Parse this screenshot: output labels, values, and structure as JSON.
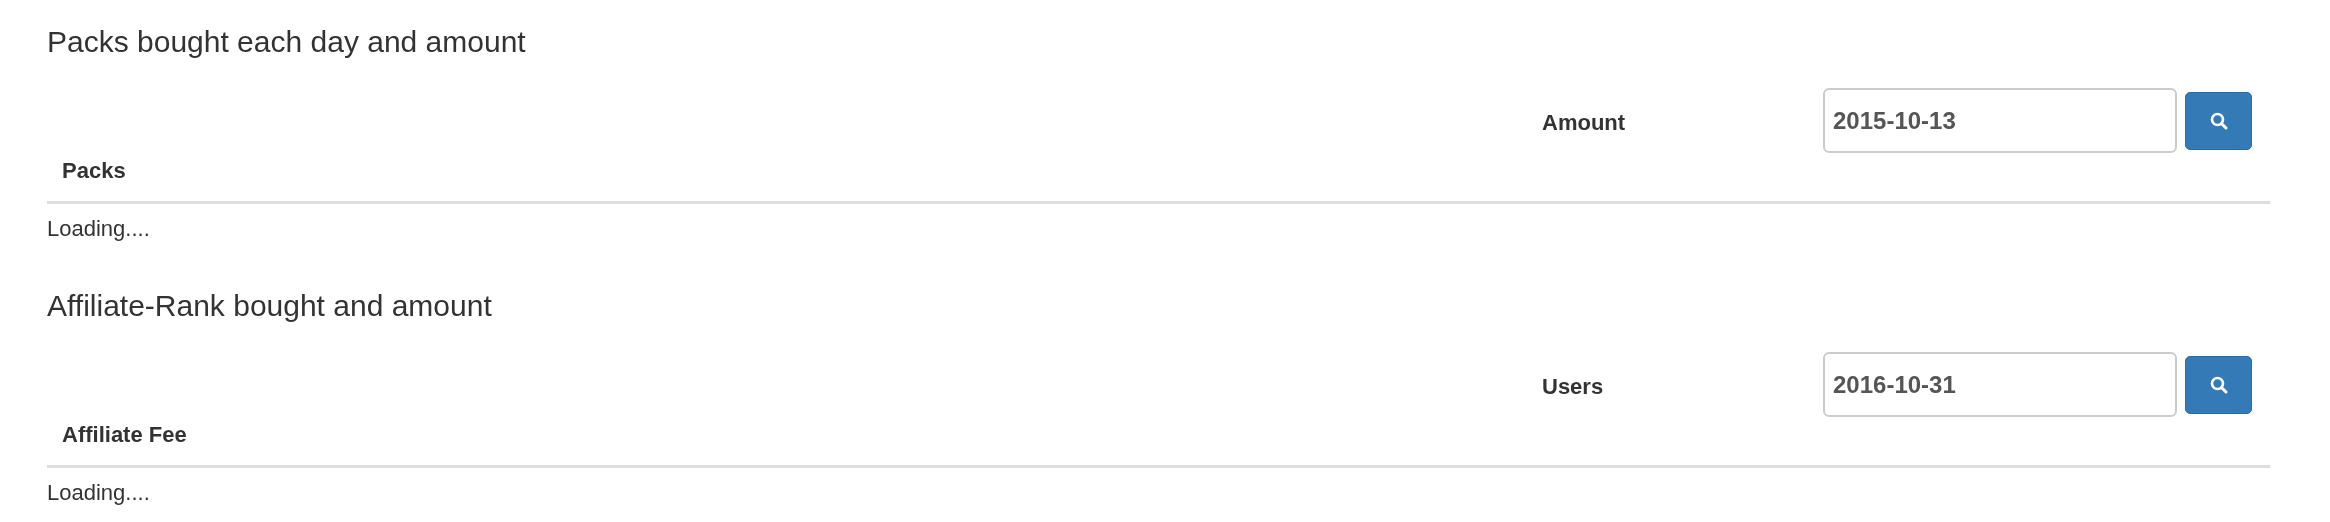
{
  "sections": [
    {
      "title": "Packs bought each day and amount",
      "columns": [
        "Packs",
        "Amount"
      ],
      "date_field": {
        "value": "2015-10-13"
      },
      "status": "Loading...."
    },
    {
      "title": "Affiliate-Rank bought and amount",
      "columns": [
        "Affiliate Fee",
        "Users"
      ],
      "date_field": {
        "value": "2016-10-31"
      },
      "status": "Loading...."
    }
  ]
}
